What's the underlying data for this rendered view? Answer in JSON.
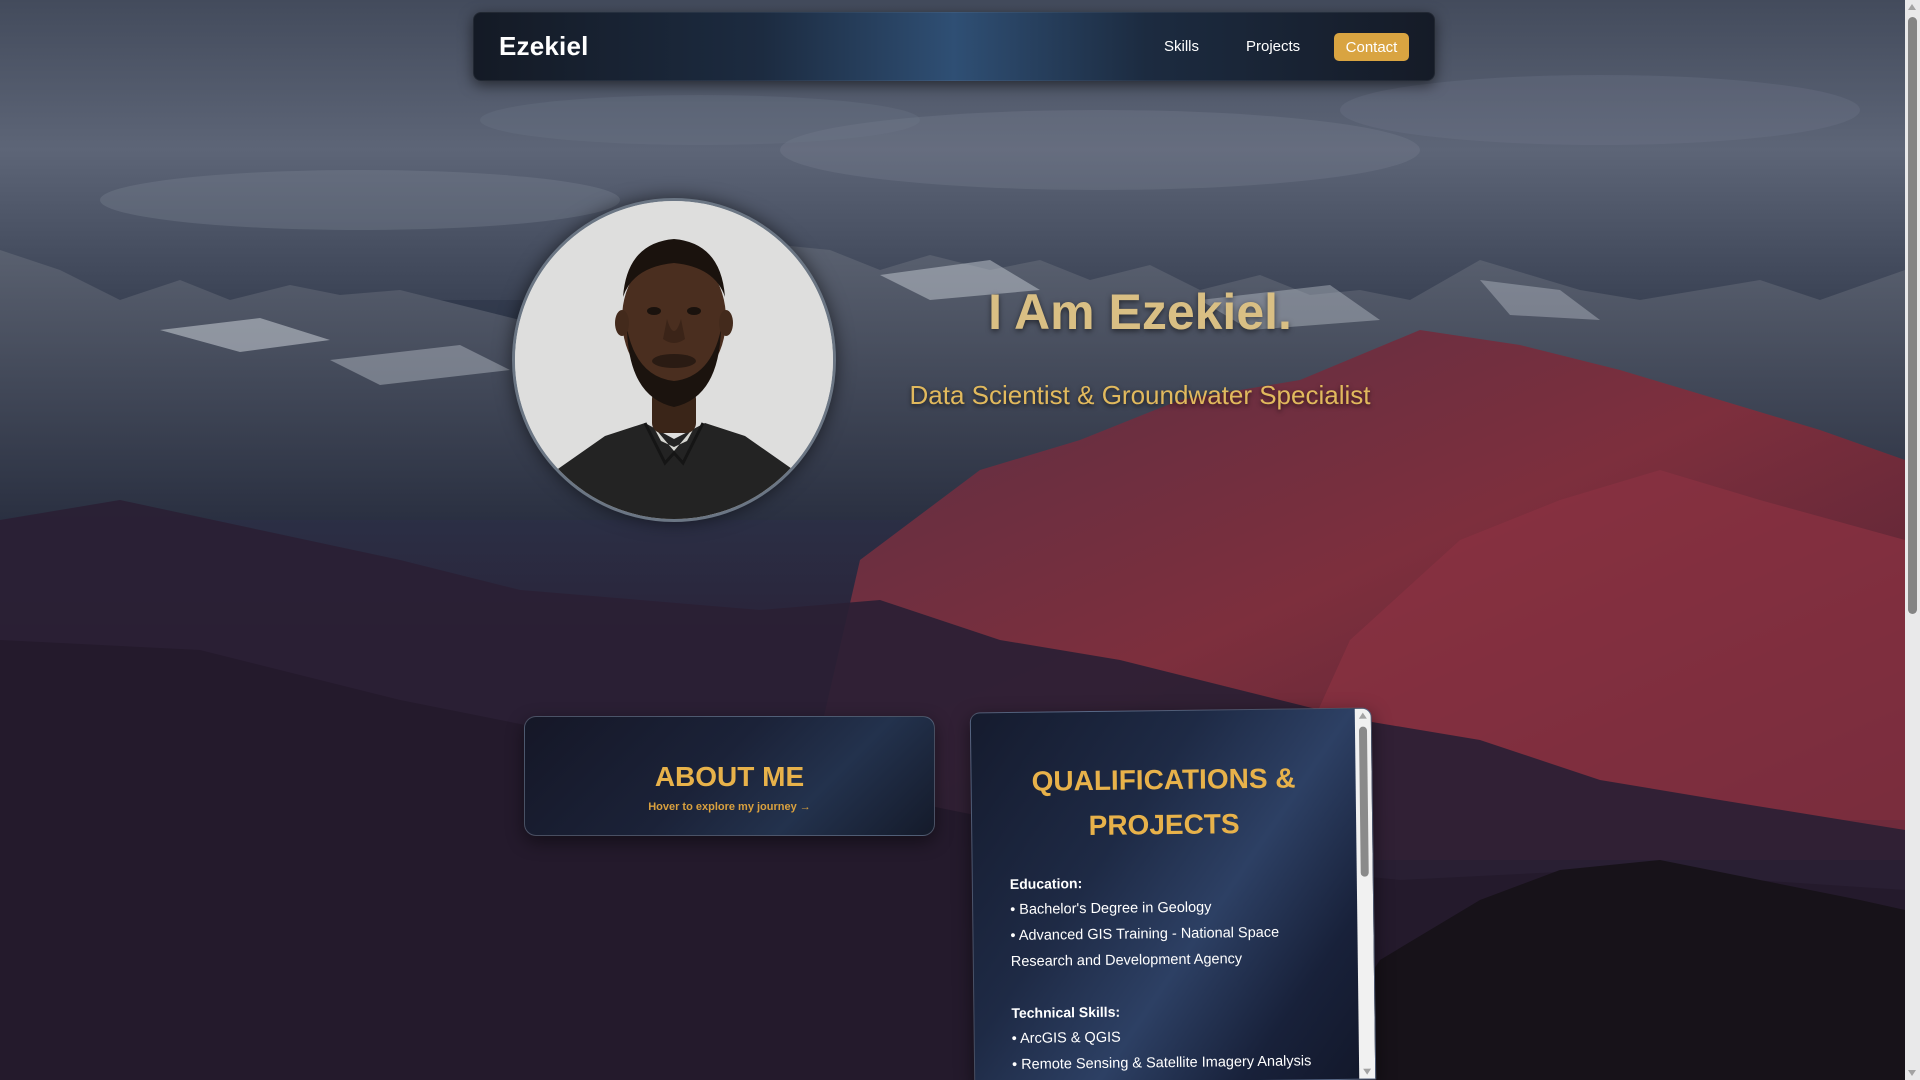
{
  "navbar": {
    "brand": "Ezekiel",
    "links": [
      {
        "label": "Skills"
      },
      {
        "label": "Projects"
      }
    ],
    "contact_label": "Contact",
    "accent_color": "#d9a441"
  },
  "hero": {
    "title": "I Am Ezekiel.",
    "subtitle": "Data Scientist & Groundwater Specialist",
    "title_color": "#d9bf84",
    "subtitle_color": "#e1b95d"
  },
  "about": {
    "title": "ABOUT ME",
    "hint": "Hover to explore my journey →"
  },
  "qualifications": {
    "title_line1": "QUALIFICATIONS &",
    "title_line2": "PROJECTS",
    "education": {
      "heading": "Education:",
      "items": [
        "• Bachelor's Degree in Geology",
        "• Advanced GIS Training - National Space Research and Development Agency"
      ]
    },
    "technical": {
      "heading": "Technical Skills:",
      "items": [
        "• ArcGIS & QGIS",
        "• Remote Sensing & Satellite Imagery Analysis"
      ]
    }
  },
  "icons": {
    "avatar": "profile-photo",
    "scroll_up": "chevron-up-icon",
    "scroll_down": "chevron-down-icon"
  }
}
